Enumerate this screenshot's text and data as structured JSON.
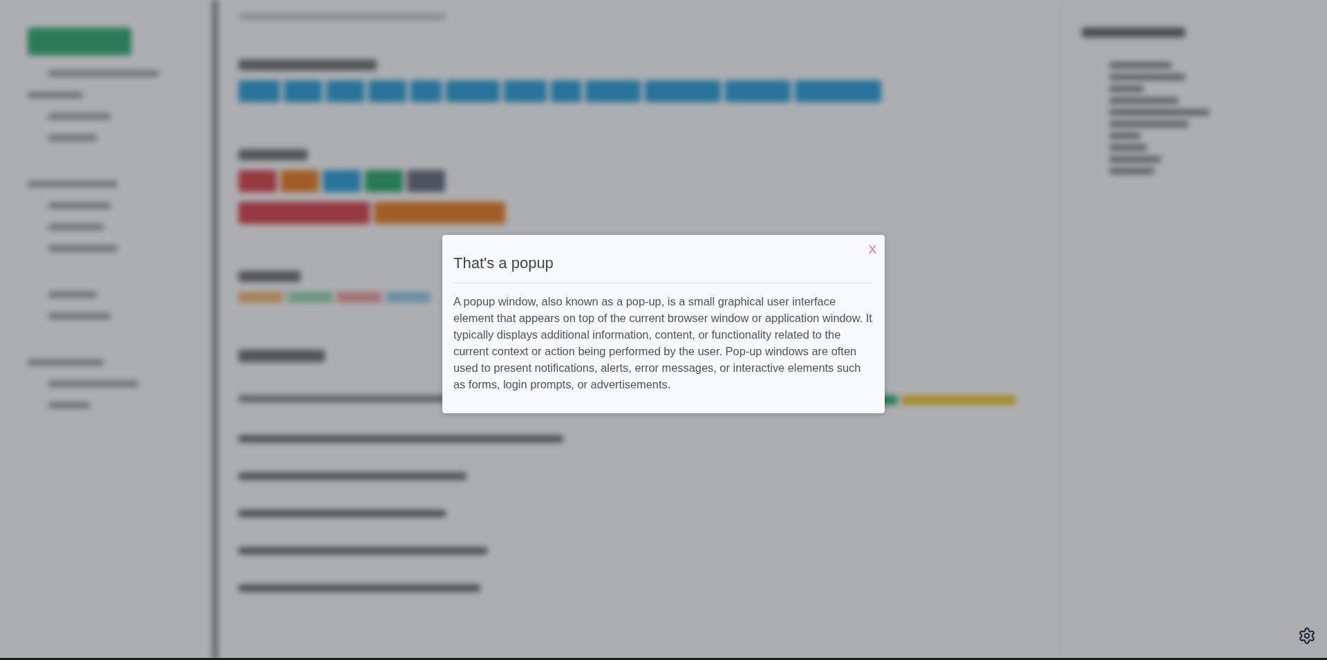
{
  "background": {
    "blurred": true
  },
  "popup": {
    "title": "That's a popup",
    "body": "A popup window, also known as a pop-up, is a small graphical user interface element that appears on top of the current browser window or application window. It typically displays additional information, content, or functionality related to the current context or action being performed by the user. Pop-up windows are often used to present notifications, alerts, error messages, or interactive elements such as forms, login prompts, or advertisements.",
    "close_label": "X"
  }
}
